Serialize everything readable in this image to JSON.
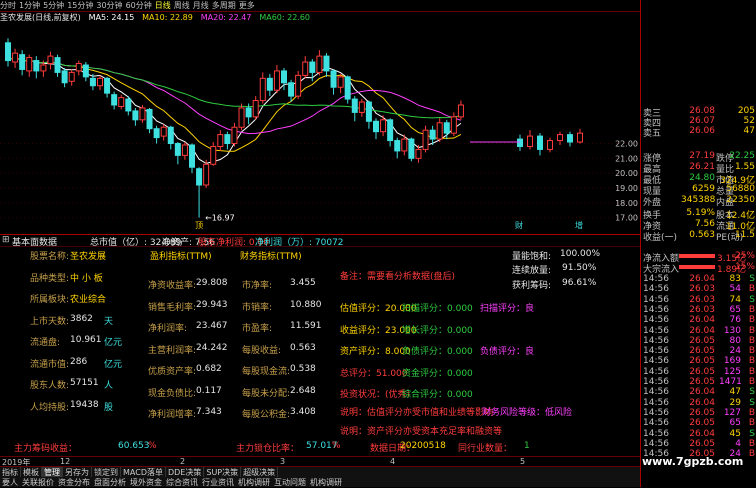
{
  "topbar": {
    "periods": [
      "分时",
      "1分钟",
      "5分钟",
      "15分钟",
      "30分钟",
      "60分钟",
      "日线",
      "周线",
      "月线",
      "多周期",
      "更多"
    ],
    "active": 6
  },
  "stock": {
    "name": "圣农发展(日线,前复权)",
    "ma5": "MA5: 24.15",
    "ma10": "MA10: 22.89",
    "ma20": "MA20: 22.47",
    "ma60": "MA60: 22.60"
  },
  "chart": {
    "low_label": "16.97",
    "marker_low": "顶",
    "price_axis": [
      "22.00",
      "21.00",
      "20.00",
      "19.00",
      "18.00",
      "17.00"
    ],
    "candles": [
      [
        28.8,
        27.6,
        29.1,
        27.2
      ],
      [
        27.5,
        28.1,
        28.4,
        27.1
      ],
      [
        28.0,
        27.0,
        28.3,
        26.6
      ],
      [
        26.9,
        27.8,
        28.0,
        26.5
      ],
      [
        27.6,
        26.9,
        27.9,
        26.4
      ],
      [
        26.9,
        27.3,
        27.6,
        26.5
      ],
      [
        27.4,
        27.9,
        28.2,
        27.0
      ],
      [
        27.8,
        26.8,
        28.0,
        26.5
      ],
      [
        26.9,
        26.1,
        27.1,
        25.8
      ],
      [
        26.2,
        26.8,
        27.0,
        25.9
      ],
      [
        26.9,
        27.4,
        27.6,
        26.6
      ],
      [
        27.3,
        26.5,
        27.5,
        26.2
      ],
      [
        26.4,
        25.9,
        26.7,
        25.6
      ],
      [
        25.9,
        26.4,
        26.6,
        25.6
      ],
      [
        26.4,
        25.4,
        26.5,
        25.1
      ],
      [
        25.3,
        24.6,
        25.5,
        24.3
      ],
      [
        24.5,
        25.1,
        25.3,
        24.3
      ],
      [
        25.0,
        24.2,
        25.2,
        23.9
      ],
      [
        24.2,
        23.6,
        24.4,
        23.2
      ],
      [
        23.6,
        24.4,
        24.6,
        23.4
      ],
      [
        24.3,
        23.0,
        24.4,
        22.7
      ],
      [
        23.0,
        22.4,
        23.2,
        22.0
      ],
      [
        22.5,
        23.1,
        23.3,
        22.2
      ],
      [
        23.1,
        22.0,
        23.2,
        21.6
      ],
      [
        22.0,
        21.2,
        22.1,
        20.6
      ],
      [
        21.2,
        21.9,
        22.1,
        20.9
      ],
      [
        21.9,
        20.4,
        22.0,
        20.0
      ],
      [
        20.3,
        19.2,
        20.4,
        17.0
      ],
      [
        19.2,
        20.6,
        20.9,
        19.0
      ],
      [
        20.6,
        21.8,
        22.1,
        20.5
      ],
      [
        21.8,
        22.6,
        22.9,
        21.5
      ],
      [
        22.6,
        22.0,
        22.8,
        21.6
      ],
      [
        22.0,
        23.1,
        23.4,
        21.8
      ],
      [
        23.1,
        24.4,
        24.7,
        22.9
      ],
      [
        24.4,
        23.8,
        24.7,
        23.3
      ],
      [
        23.8,
        24.9,
        25.2,
        23.6
      ],
      [
        24.9,
        26.4,
        26.8,
        24.7
      ],
      [
        26.4,
        25.6,
        26.7,
        25.2
      ],
      [
        25.6,
        26.9,
        27.3,
        25.4
      ],
      [
        26.9,
        26.1,
        27.1,
        25.6
      ],
      [
        26.1,
        25.2,
        26.3,
        24.8
      ],
      [
        25.2,
        26.6,
        26.9,
        25.0
      ],
      [
        26.6,
        27.5,
        27.9,
        26.4
      ],
      [
        27.5,
        26.8,
        27.7,
        26.2
      ],
      [
        26.8,
        27.9,
        28.3,
        26.6
      ],
      [
        27.9,
        26.9,
        28.1,
        26.5
      ],
      [
        26.9,
        25.8,
        27.0,
        25.3
      ],
      [
        25.8,
        26.5,
        26.7,
        25.4
      ],
      [
        26.5,
        25.0,
        26.6,
        24.7
      ],
      [
        25.0,
        24.1,
        25.2,
        23.5
      ],
      [
        24.1,
        24.8,
        25.0,
        23.8
      ],
      [
        24.8,
        23.5,
        24.9,
        23.0
      ],
      [
        23.5,
        22.8,
        23.7,
        22.3
      ],
      [
        22.8,
        23.6,
        23.9,
        22.5
      ],
      [
        23.6,
        22.2,
        23.7,
        21.8
      ],
      [
        22.2,
        21.5,
        22.4,
        21.0
      ],
      [
        21.5,
        22.3,
        22.6,
        21.2
      ],
      [
        22.3,
        21.0,
        22.4,
        20.8
      ],
      [
        21.0,
        21.6,
        21.9,
        20.7
      ],
      [
        21.6,
        22.9,
        23.2,
        21.4
      ],
      [
        22.9,
        22.3,
        23.2,
        21.9
      ],
      [
        22.3,
        23.4,
        23.7,
        22.1
      ],
      [
        23.4,
        22.7,
        23.6,
        22.3
      ],
      [
        22.7,
        23.8,
        24.1,
        22.5
      ],
      [
        23.8,
        24.6,
        24.9,
        23.6
      ]
    ],
    "right_candles": [
      [
        22.3,
        21.8,
        22.6,
        21.5
      ],
      [
        21.8,
        22.5,
        22.9,
        21.6
      ],
      [
        22.5,
        21.6,
        22.7,
        21.2
      ],
      [
        21.6,
        22.2,
        22.4,
        21.4
      ],
      [
        22.2,
        22.6,
        22.8,
        21.9
      ],
      [
        22.6,
        22.1,
        22.8,
        21.8
      ],
      [
        22.1,
        22.7,
        23.0,
        22.0
      ]
    ],
    "ymin": 16.5,
    "ymax": 30.0,
    "axis_bottom_labels": [
      "财",
      "增"
    ]
  },
  "right_panel": {
    "sell_rows": [
      [
        "卖三",
        "26.08",
        "205"
      ],
      [
        "卖四",
        "26.07",
        "52"
      ],
      [
        "卖五",
        "26.06",
        "47"
      ]
    ],
    "quote_rows": [
      [
        "涨停",
        "27.19",
        "跌停",
        "22.25"
      ],
      [
        "最高",
        "26.21",
        "量比",
        "1.55"
      ],
      [
        "最低",
        "24.80",
        "市值",
        "324.9亿"
      ],
      [
        "现量",
        "6259",
        "总量",
        "56880"
      ],
      [
        "外盘",
        "345388",
        "内盘",
        "22350"
      ],
      [
        "换手",
        "5.19%",
        "股本",
        "12.4亿"
      ],
      [
        "净资",
        "7.56",
        "流通",
        "11.0亿"
      ],
      [
        "收益(一)",
        "0.563",
        "PE(动)",
        "11.5"
      ]
    ],
    "flow_rows": [
      [
        "净流入额",
        "3.15亿",
        "25%"
      ],
      [
        "大宗流入",
        "1.89亿",
        "15%"
      ]
    ],
    "ticks": [
      [
        "14:56",
        "26.04",
        "83",
        "S"
      ],
      [
        "14:56",
        "26.03",
        "54",
        "B"
      ],
      [
        "14:56",
        "26.03",
        "74",
        "S"
      ],
      [
        "14:56",
        "26.03",
        "65",
        "B"
      ],
      [
        "14:56",
        "26.04",
        "76",
        "B"
      ],
      [
        "14:56",
        "26.04",
        "130",
        "B"
      ],
      [
        "14:56",
        "26.05",
        "80",
        "B"
      ],
      [
        "14:56",
        "26.05",
        "24",
        "B"
      ],
      [
        "14:56",
        "26.05",
        "169",
        "B"
      ],
      [
        "14:56",
        "26.05",
        "125",
        "B"
      ],
      [
        "14:56",
        "26.05",
        "1471",
        "B"
      ],
      [
        "14:56",
        "26.04",
        "47",
        "S"
      ],
      [
        "14:56",
        "26.04",
        "29",
        "S"
      ],
      [
        "14:56",
        "26.05",
        "127",
        "B"
      ],
      [
        "14:56",
        "26.05",
        "65",
        "B"
      ],
      [
        "14:56",
        "26.04",
        "45",
        "S"
      ],
      [
        "14:56",
        "26.05",
        "4",
        "B"
      ],
      [
        "14:56",
        "26.05",
        "24",
        "B"
      ]
    ]
  },
  "basic": {
    "header_title": "基本面数据",
    "header_info": "总市值（亿）: 324.89",
    "header_net": "净资产: 7.56",
    "header_dividend": "股东净利润: 0.00",
    "header_netprofit": "净利润（万）: 70072",
    "col_titles": [
      "盈利指标(TTM)",
      "财务指标(TTM)",
      "量能饱和:",
      "100.00%",
      "连续放量:",
      "91.50%",
      "获利筹码:",
      "96.61%"
    ],
    "left_rows": [
      [
        "股票名称:",
        "圣农发展",
        ""
      ],
      [
        "品种类型:",
        "中 小 板",
        ""
      ],
      [
        "所属板块:",
        "农业综合",
        ""
      ],
      [
        "上市天数:",
        "3862",
        "天"
      ],
      [
        "流通盘:",
        "10.961",
        "亿元"
      ],
      [
        "流通市值:",
        "286",
        "亿元"
      ],
      [
        "股东人数:",
        "57151",
        "人"
      ],
      [
        "人均持股:",
        "19438",
        "股"
      ]
    ],
    "mid_rows": [
      [
        "净资收益率:",
        "29.808"
      ],
      [
        "销售毛利率:",
        "29.943"
      ],
      [
        "净利润率:",
        "23.467"
      ],
      [
        "主营利润率:",
        "24.242"
      ],
      [
        "优质资产率:",
        "0.682"
      ],
      [
        "现金负债比:",
        "0.117"
      ],
      [
        "净利润增率:",
        "7.343"
      ]
    ],
    "fin_rows": [
      [
        "市净率:",
        "3.455"
      ],
      [
        "市销率:",
        "10.880"
      ],
      [
        "市盈率:",
        "11.591"
      ],
      [
        "每股收益:",
        "0.563"
      ],
      [
        "每股现金流:",
        "0.538"
      ],
      [
        "每股未分配:",
        "2.648"
      ],
      [
        "每股公积金:",
        "3.408"
      ]
    ],
    "note": "备注：需要看分析数据(盘后)",
    "scores": [
      [
        "估值评分：20.000",
        "扫描评分：0.000",
        "扫描评分：良"
      ],
      [
        "收益评分：23.000",
        "增长评分：0.000",
        ""
      ],
      [
        "资产评分：8.000",
        "负债评分：0.000",
        "负债评分：良"
      ],
      [
        "总评分：51.000",
        "资金评分：0.000",
        ""
      ],
      [
        "投资状况：(优秀)",
        "综合评分：0.000",
        ""
      ]
    ],
    "notice1": "说明：估值评分亦受市值和业绩等影响",
    "notice1b": "财务风险等级：低风险",
    "notice2": "说明：资产评分亦受资本充足率和融资等",
    "footer": [
      "主力筹码收益：",
      "60.653",
      "%",
      "主力锁仓比率：",
      "57.017",
      "%",
      "数据日期：",
      "20200518",
      "同行业数量：",
      "1"
    ]
  },
  "time_axis": [
    "2019年",
    "12",
    "2",
    "3",
    "4",
    "5"
  ],
  "bottom_tabs": [
    "指标",
    "模板",
    "管理",
    "另存为",
    "锁定到",
    "MACD落单",
    "DDE决策",
    "SUP决策",
    "超级决策"
  ],
  "bottom_tabs2": [
    "要人",
    "关联报价",
    "资金分布",
    "盘面分析",
    "境外资金",
    "综合资讯",
    "行业资讯",
    "机构调研",
    "互动问题",
    "机构调研"
  ],
  "watermark": "www.7gpzb.com",
  "colors": {
    "up": "#ff3c3c",
    "down": "#2ecc40",
    "ma5": "#ffffff",
    "ma10": "#ffd400",
    "ma20": "#ff40ff",
    "ma60": "#2ecc40"
  }
}
